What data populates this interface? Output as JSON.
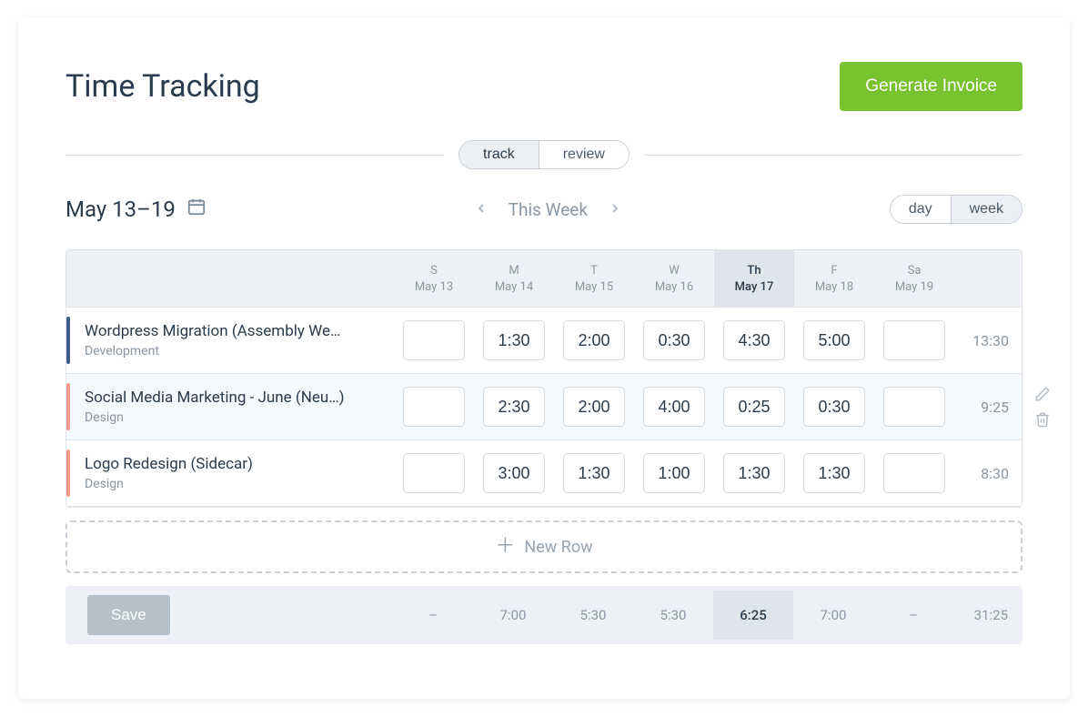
{
  "header": {
    "title": "Time Tracking",
    "generate_label": "Generate Invoice"
  },
  "tabs": {
    "track": "track",
    "review": "review",
    "active": "track"
  },
  "date": {
    "range": "May 13–19",
    "this_week": "This Week"
  },
  "view": {
    "day": "day",
    "week": "week",
    "active": "week"
  },
  "days": [
    {
      "abbr": "S",
      "date": "May 13",
      "today": false
    },
    {
      "abbr": "M",
      "date": "May 14",
      "today": false
    },
    {
      "abbr": "T",
      "date": "May 15",
      "today": false
    },
    {
      "abbr": "W",
      "date": "May 16",
      "today": false
    },
    {
      "abbr": "Th",
      "date": "May 17",
      "today": true
    },
    {
      "abbr": "F",
      "date": "May 18",
      "today": false
    },
    {
      "abbr": "Sa",
      "date": "May 19",
      "today": false
    }
  ],
  "rows": [
    {
      "title": "Wordpress Migration (Assembly We…",
      "category": "Development",
      "color": "#3f5a87",
      "times": [
        "",
        "1:30",
        "2:00",
        "0:30",
        "4:30",
        "5:00",
        ""
      ],
      "total": "13:30",
      "active": false
    },
    {
      "title": "Social Media Marketing - June (Neu…)",
      "category": "Design",
      "color": "#f79b8e",
      "times": [
        "",
        "2:30",
        "2:00",
        "4:00",
        "0:25",
        "0:30",
        ""
      ],
      "total": "9:25",
      "active": true
    },
    {
      "title": "Logo Redesign (Sidecar)",
      "category": "Design",
      "color": "#f79b8e",
      "times": [
        "",
        "3:00",
        "1:30",
        "1:00",
        "1:30",
        "1:30",
        ""
      ],
      "total": "8:30",
      "active": false
    }
  ],
  "new_row_label": "New Row",
  "footer": {
    "save_label": "Save",
    "totals": [
      "–",
      "7:00",
      "5:30",
      "5:30",
      "6:25",
      "7:00",
      "–"
    ],
    "grand_total": "31:25"
  }
}
